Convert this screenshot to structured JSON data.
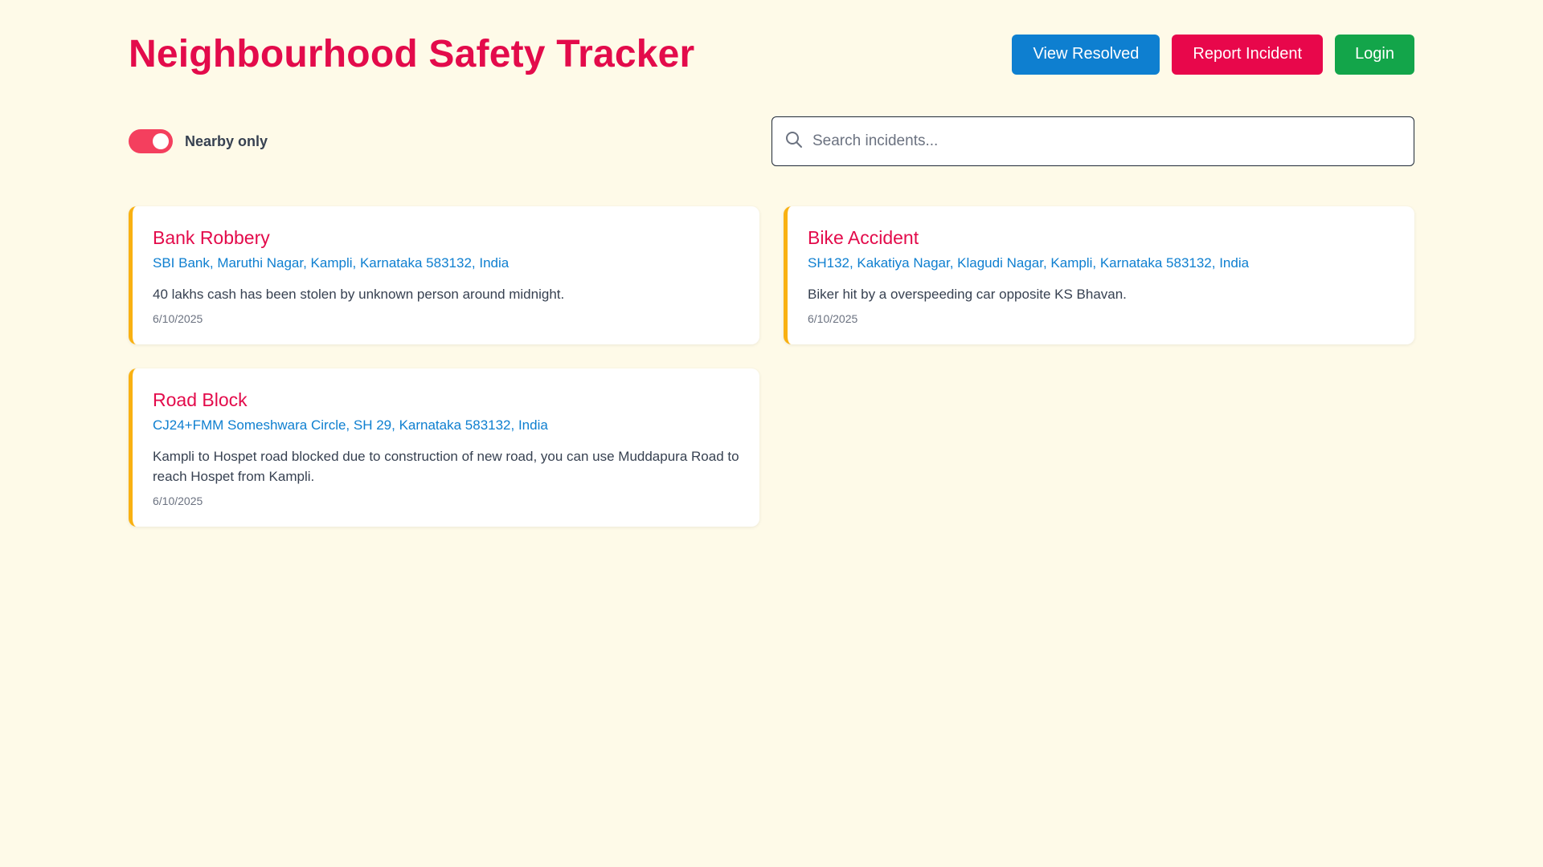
{
  "header": {
    "title": "Neighbourhood Safety Tracker",
    "buttons": {
      "view_resolved": "View Resolved",
      "report_incident": "Report Incident",
      "login": "Login"
    }
  },
  "filters": {
    "nearby_toggle": {
      "label": "Nearby only",
      "checked": true
    },
    "search": {
      "placeholder": "Search incidents...",
      "value": ""
    }
  },
  "incidents": [
    {
      "title": "Bank Robbery",
      "address": "SBI Bank, Maruthi Nagar, Kampli, Karnataka 583132, India",
      "description": "40 lakhs cash has been stolen by unknown person around midnight.",
      "date": "6/10/2025"
    },
    {
      "title": "Bike Accident",
      "address": "SH132, Kakatiya Nagar, Klagudi Nagar, Kampli, Karnataka 583132, India",
      "description": "Biker hit by a overspeeding car opposite KS Bhavan.",
      "date": "6/10/2025"
    },
    {
      "title": "Road Block",
      "address": "CJ24+FMM Someshwara Circle, SH 29, Karnataka 583132, India",
      "description": "Kampli to Hospet road blocked due to construction of new road, you can use Muddapura Road to reach Hospet from Kampli.",
      "date": "6/10/2025"
    }
  ],
  "colors": {
    "background": "#fefae8",
    "title": "#e30b4b",
    "view_resolved": "#0e7fd0",
    "report_incident": "#e8074b",
    "login": "#13a54a",
    "toggle_on": "#f43f5e",
    "card_accent": "#f9b112",
    "address_link": "#0e7fd0"
  },
  "icons": {
    "search": "search-icon"
  }
}
